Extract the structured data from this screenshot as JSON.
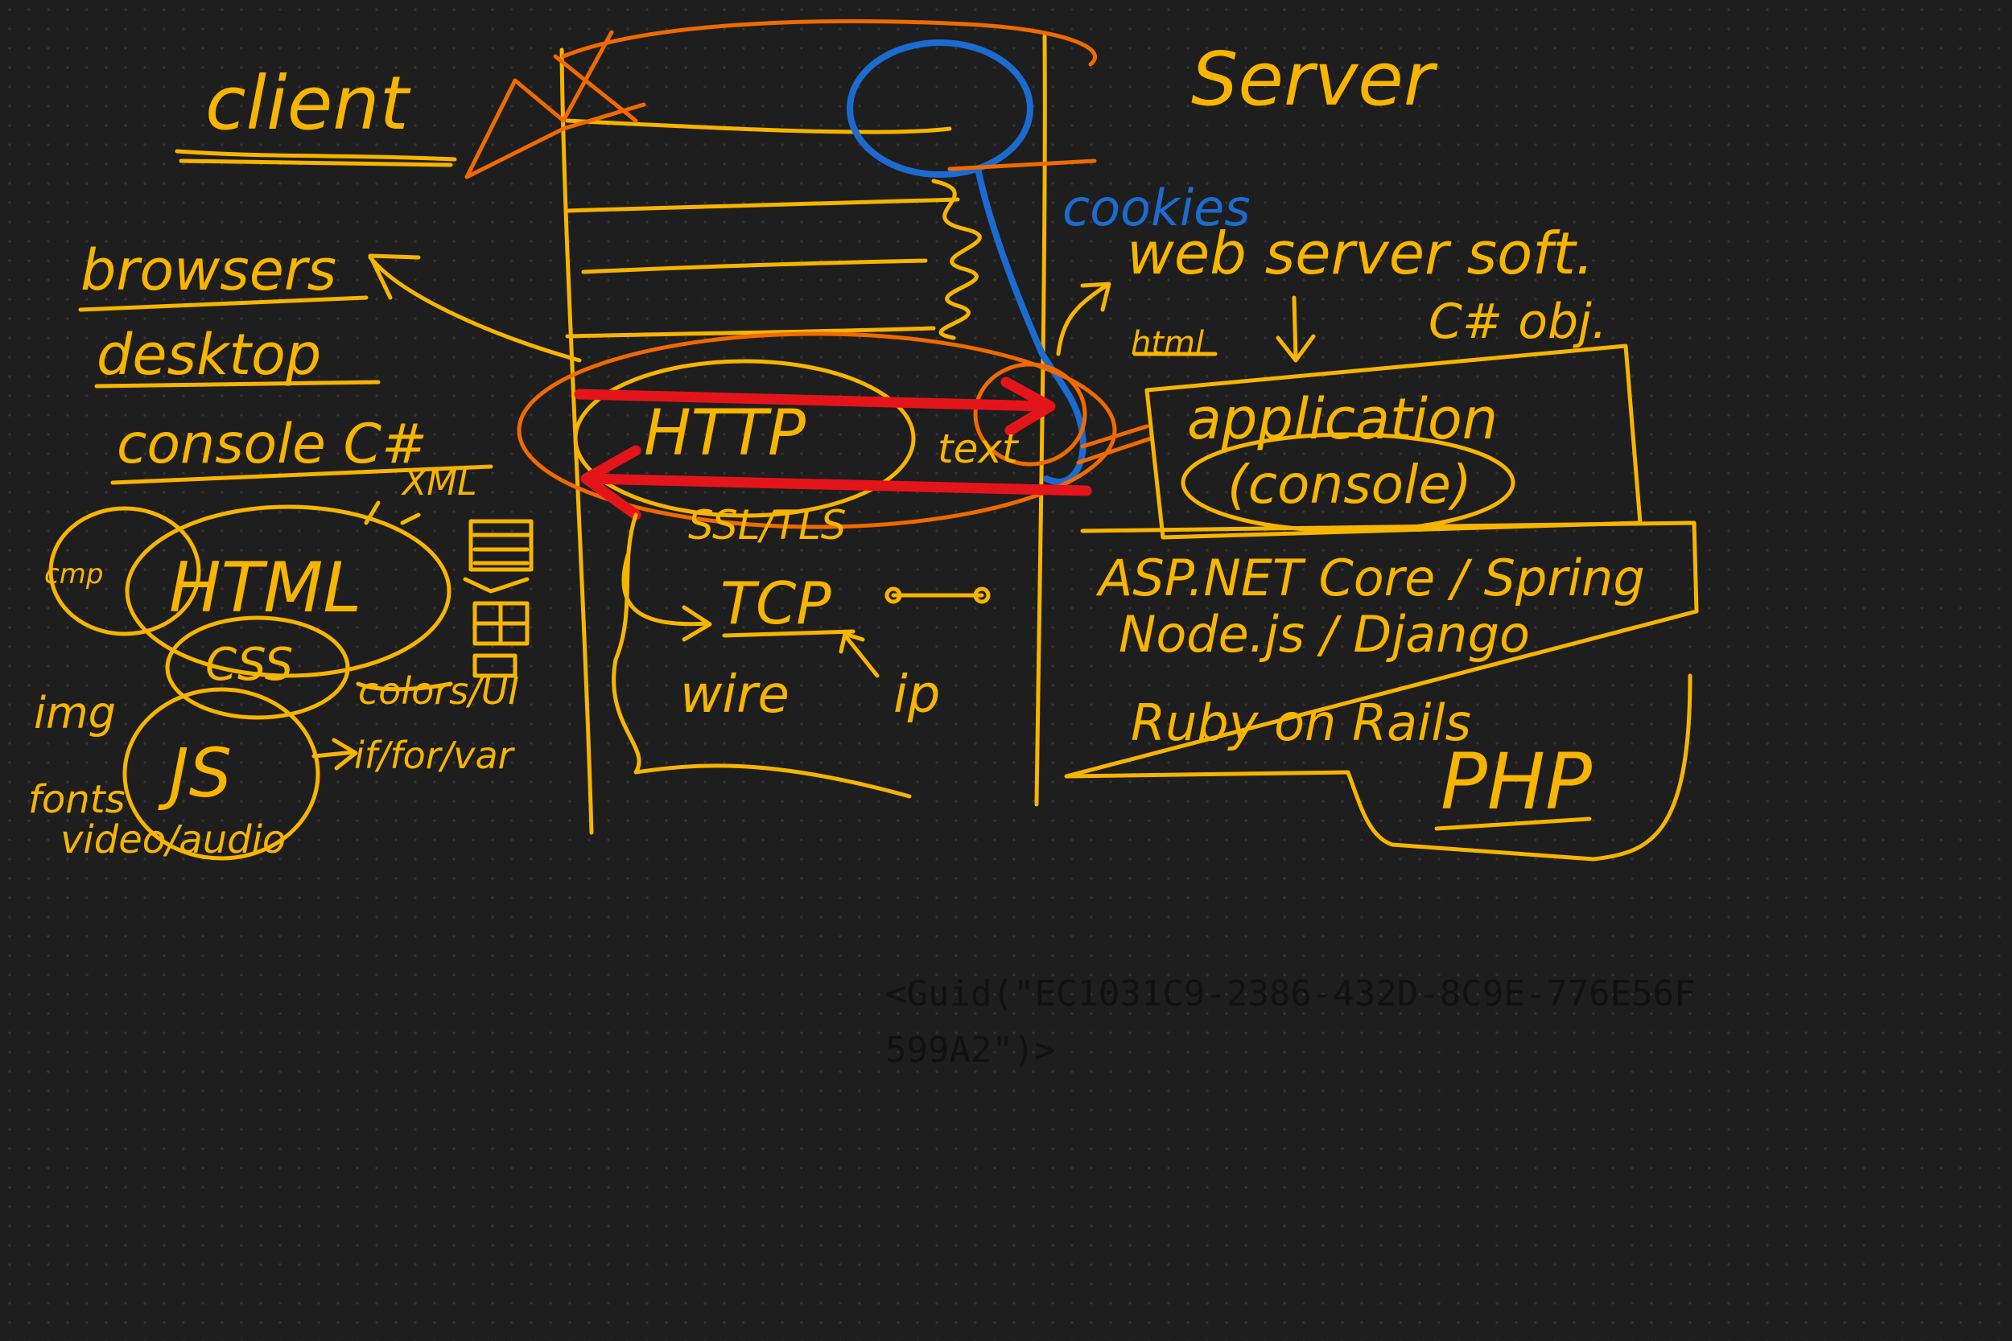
{
  "colors": {
    "background": "#1e1e1e",
    "yellow_ink": "#f7b500",
    "orange_ink": "#f06a00",
    "blue_ink": "#1c6bd0",
    "red_ink": "#e4141b",
    "guid_text": "#111111"
  },
  "client": {
    "title": "client",
    "items": [
      "browsers",
      "desktop",
      "console C#"
    ],
    "xml_label": "XML",
    "html_label": "HTML",
    "css_label": "CSS",
    "js_label": "JS",
    "mini_label": "cmp",
    "colors_label": "colors/UI",
    "logic_label": "if/for/var",
    "media": [
      "img",
      "fonts",
      "video/audio"
    ]
  },
  "middle": {
    "http_label": "HTTP",
    "text_label": "text",
    "ssl_label": "SSL/TLS",
    "tcp_label": "TCP",
    "ip_label": "ip",
    "wire_label": "wire"
  },
  "server": {
    "title": "Server",
    "cookies_label": "cookies",
    "web_server_label": "web server soft.",
    "cs_obj_label": "C# obj.",
    "html_note": "html",
    "application_label": "application",
    "console_label": "(console)",
    "frameworks": [
      "ASP.NET Core / Spring",
      "Node.js / Django",
      "Ruby on Rails"
    ],
    "php_label": "PHP"
  },
  "guid": {
    "line1": "<Guid(\"EC1031C9-2386-432D-8C9E-776E56F",
    "line2": "599A2\")>"
  }
}
